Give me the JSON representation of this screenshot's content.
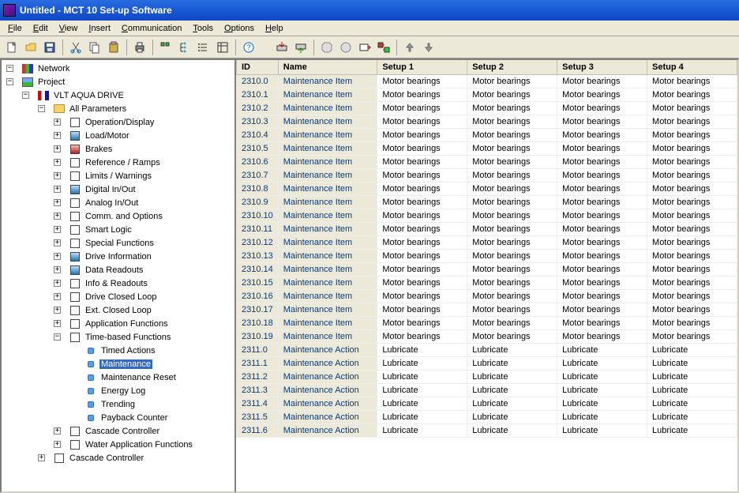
{
  "window": {
    "title": "Untitled - MCT 10 Set-up Software"
  },
  "menu": {
    "items": [
      "File",
      "Edit",
      "View",
      "Insert",
      "Communication",
      "Tools",
      "Options",
      "Help"
    ]
  },
  "tree": {
    "nodes": [
      {
        "level": 0,
        "exp": "-",
        "icon": "network",
        "label": "Network",
        "selected": false
      },
      {
        "level": 0,
        "exp": "-",
        "icon": "project",
        "label": "Project",
        "selected": false
      },
      {
        "level": 1,
        "exp": "-",
        "icon": "drive",
        "label": "VLT AQUA DRIVE",
        "selected": false
      },
      {
        "level": 2,
        "exp": "-",
        "icon": "folder",
        "label": "All Parameters",
        "selected": false
      },
      {
        "level": 3,
        "exp": "+",
        "icon": "mod",
        "label": "Operation/Display",
        "selected": false
      },
      {
        "level": 3,
        "exp": "+",
        "icon": "mod-blue",
        "label": "Load/Motor",
        "selected": false
      },
      {
        "level": 3,
        "exp": "+",
        "icon": "mod-red",
        "label": "Brakes",
        "selected": false
      },
      {
        "level": 3,
        "exp": "+",
        "icon": "mod",
        "label": "Reference / Ramps",
        "selected": false
      },
      {
        "level": 3,
        "exp": "+",
        "icon": "mod",
        "label": "Limits / Warnings",
        "selected": false
      },
      {
        "level": 3,
        "exp": "+",
        "icon": "mod-blue",
        "label": "Digital In/Out",
        "selected": false
      },
      {
        "level": 3,
        "exp": "+",
        "icon": "mod",
        "label": "Analog In/Out",
        "selected": false
      },
      {
        "level": 3,
        "exp": "+",
        "icon": "mod",
        "label": "Comm. and Options",
        "selected": false
      },
      {
        "level": 3,
        "exp": "+",
        "icon": "mod",
        "label": "Smart Logic",
        "selected": false
      },
      {
        "level": 3,
        "exp": "+",
        "icon": "mod",
        "label": "Special Functions",
        "selected": false
      },
      {
        "level": 3,
        "exp": "+",
        "icon": "mod-blue",
        "label": "Drive Information",
        "selected": false
      },
      {
        "level": 3,
        "exp": "+",
        "icon": "mod-blue",
        "label": "Data Readouts",
        "selected": false
      },
      {
        "level": 3,
        "exp": "+",
        "icon": "mod",
        "label": "Info & Readouts",
        "selected": false
      },
      {
        "level": 3,
        "exp": "+",
        "icon": "mod",
        "label": "Drive Closed Loop",
        "selected": false
      },
      {
        "level": 3,
        "exp": "+",
        "icon": "mod",
        "label": "Ext. Closed Loop",
        "selected": false
      },
      {
        "level": 3,
        "exp": "+",
        "icon": "mod",
        "label": "Application Functions",
        "selected": false
      },
      {
        "level": 3,
        "exp": "-",
        "icon": "mod",
        "label": "Time-based Functions",
        "selected": false
      },
      {
        "level": 4,
        "exp": " ",
        "icon": "dot",
        "label": "Timed Actions",
        "selected": false
      },
      {
        "level": 4,
        "exp": " ",
        "icon": "dot",
        "label": "Maintenance",
        "selected": true
      },
      {
        "level": 4,
        "exp": " ",
        "icon": "dot",
        "label": "Maintenance Reset",
        "selected": false
      },
      {
        "level": 4,
        "exp": " ",
        "icon": "dot",
        "label": "Energy Log",
        "selected": false
      },
      {
        "level": 4,
        "exp": " ",
        "icon": "dot",
        "label": "Trending",
        "selected": false
      },
      {
        "level": 4,
        "exp": " ",
        "icon": "dot",
        "label": "Payback Counter",
        "selected": false
      },
      {
        "level": 3,
        "exp": "+",
        "icon": "mod",
        "label": "Cascade Controller",
        "selected": false
      },
      {
        "level": 3,
        "exp": "+",
        "icon": "mod",
        "label": "Water Application Functions",
        "selected": false
      },
      {
        "level": 2,
        "exp": "+",
        "icon": "mod",
        "label": "Cascade Controller",
        "selected": false
      }
    ]
  },
  "table": {
    "headers": [
      "ID",
      "Name",
      "Setup 1",
      "Setup 2",
      "Setup 3",
      "Setup 4"
    ],
    "rows": [
      {
        "id": "2310.0",
        "name": "Maintenance Item",
        "s1": "Motor bearings",
        "s2": "Motor bearings",
        "s3": "Motor bearings",
        "s4": "Motor bearings"
      },
      {
        "id": "2310.1",
        "name": "Maintenance Item",
        "s1": "Motor bearings",
        "s2": "Motor bearings",
        "s3": "Motor bearings",
        "s4": "Motor bearings"
      },
      {
        "id": "2310.2",
        "name": "Maintenance Item",
        "s1": "Motor bearings",
        "s2": "Motor bearings",
        "s3": "Motor bearings",
        "s4": "Motor bearings"
      },
      {
        "id": "2310.3",
        "name": "Maintenance Item",
        "s1": "Motor bearings",
        "s2": "Motor bearings",
        "s3": "Motor bearings",
        "s4": "Motor bearings"
      },
      {
        "id": "2310.4",
        "name": "Maintenance Item",
        "s1": "Motor bearings",
        "s2": "Motor bearings",
        "s3": "Motor bearings",
        "s4": "Motor bearings"
      },
      {
        "id": "2310.5",
        "name": "Maintenance Item",
        "s1": "Motor bearings",
        "s2": "Motor bearings",
        "s3": "Motor bearings",
        "s4": "Motor bearings"
      },
      {
        "id": "2310.6",
        "name": "Maintenance Item",
        "s1": "Motor bearings",
        "s2": "Motor bearings",
        "s3": "Motor bearings",
        "s4": "Motor bearings"
      },
      {
        "id": "2310.7",
        "name": "Maintenance Item",
        "s1": "Motor bearings",
        "s2": "Motor bearings",
        "s3": "Motor bearings",
        "s4": "Motor bearings"
      },
      {
        "id": "2310.8",
        "name": "Maintenance Item",
        "s1": "Motor bearings",
        "s2": "Motor bearings",
        "s3": "Motor bearings",
        "s4": "Motor bearings"
      },
      {
        "id": "2310.9",
        "name": "Maintenance Item",
        "s1": "Motor bearings",
        "s2": "Motor bearings",
        "s3": "Motor bearings",
        "s4": "Motor bearings"
      },
      {
        "id": "2310.10",
        "name": "Maintenance Item",
        "s1": "Motor bearings",
        "s2": "Motor bearings",
        "s3": "Motor bearings",
        "s4": "Motor bearings"
      },
      {
        "id": "2310.11",
        "name": "Maintenance Item",
        "s1": "Motor bearings",
        "s2": "Motor bearings",
        "s3": "Motor bearings",
        "s4": "Motor bearings"
      },
      {
        "id": "2310.12",
        "name": "Maintenance Item",
        "s1": "Motor bearings",
        "s2": "Motor bearings",
        "s3": "Motor bearings",
        "s4": "Motor bearings"
      },
      {
        "id": "2310.13",
        "name": "Maintenance Item",
        "s1": "Motor bearings",
        "s2": "Motor bearings",
        "s3": "Motor bearings",
        "s4": "Motor bearings"
      },
      {
        "id": "2310.14",
        "name": "Maintenance Item",
        "s1": "Motor bearings",
        "s2": "Motor bearings",
        "s3": "Motor bearings",
        "s4": "Motor bearings"
      },
      {
        "id": "2310.15",
        "name": "Maintenance Item",
        "s1": "Motor bearings",
        "s2": "Motor bearings",
        "s3": "Motor bearings",
        "s4": "Motor bearings"
      },
      {
        "id": "2310.16",
        "name": "Maintenance Item",
        "s1": "Motor bearings",
        "s2": "Motor bearings",
        "s3": "Motor bearings",
        "s4": "Motor bearings"
      },
      {
        "id": "2310.17",
        "name": "Maintenance Item",
        "s1": "Motor bearings",
        "s2": "Motor bearings",
        "s3": "Motor bearings",
        "s4": "Motor bearings"
      },
      {
        "id": "2310.18",
        "name": "Maintenance Item",
        "s1": "Motor bearings",
        "s2": "Motor bearings",
        "s3": "Motor bearings",
        "s4": "Motor bearings"
      },
      {
        "id": "2310.19",
        "name": "Maintenance Item",
        "s1": "Motor bearings",
        "s2": "Motor bearings",
        "s3": "Motor bearings",
        "s4": "Motor bearings"
      },
      {
        "id": "2311.0",
        "name": "Maintenance Action",
        "s1": "Lubricate",
        "s2": "Lubricate",
        "s3": "Lubricate",
        "s4": "Lubricate"
      },
      {
        "id": "2311.1",
        "name": "Maintenance Action",
        "s1": "Lubricate",
        "s2": "Lubricate",
        "s3": "Lubricate",
        "s4": "Lubricate"
      },
      {
        "id": "2311.2",
        "name": "Maintenance Action",
        "s1": "Lubricate",
        "s2": "Lubricate",
        "s3": "Lubricate",
        "s4": "Lubricate"
      },
      {
        "id": "2311.3",
        "name": "Maintenance Action",
        "s1": "Lubricate",
        "s2": "Lubricate",
        "s3": "Lubricate",
        "s4": "Lubricate"
      },
      {
        "id": "2311.4",
        "name": "Maintenance Action",
        "s1": "Lubricate",
        "s2": "Lubricate",
        "s3": "Lubricate",
        "s4": "Lubricate"
      },
      {
        "id": "2311.5",
        "name": "Maintenance Action",
        "s1": "Lubricate",
        "s2": "Lubricate",
        "s3": "Lubricate",
        "s4": "Lubricate"
      },
      {
        "id": "2311.6",
        "name": "Maintenance Action",
        "s1": "Lubricate",
        "s2": "Lubricate",
        "s3": "Lubricate",
        "s4": "Lubricate"
      }
    ]
  }
}
